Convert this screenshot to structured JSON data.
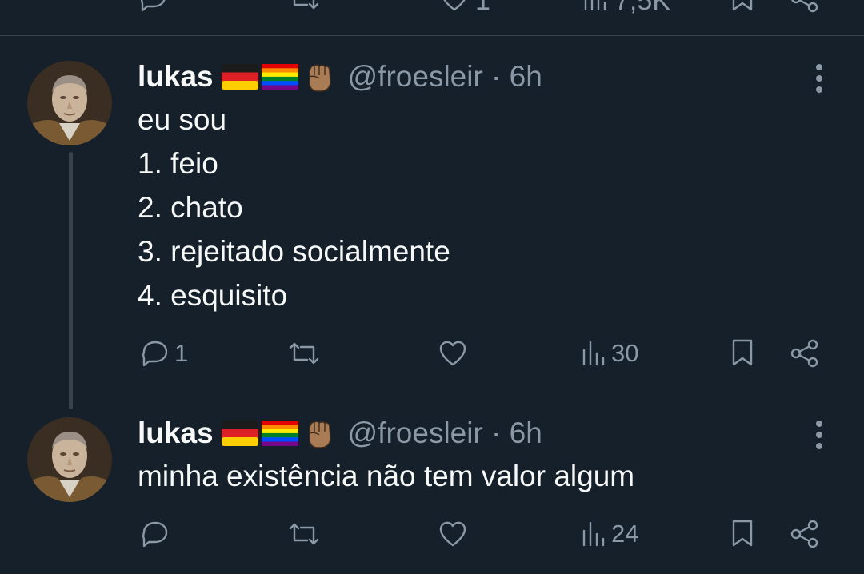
{
  "previous_tweet": {
    "views": "7,5K",
    "likes": "1"
  },
  "tweets": [
    {
      "name": "lukas",
      "emojis": [
        "germany-flag",
        "rainbow-flag",
        "raised-fist"
      ],
      "handle_time": "@froesleir · 6h",
      "lines": [
        "eu sou",
        "1. feio",
        "2. chato",
        "3. rejeitado socialmente",
        "4. esquisito"
      ],
      "replies": "1",
      "retweets": "",
      "likes": "",
      "views": "30"
    },
    {
      "name": "lukas",
      "emojis": [
        "germany-flag",
        "rainbow-flag",
        "raised-fist"
      ],
      "handle_time": "@froesleir · 6h",
      "lines": [
        "minha existência não tem valor algum"
      ],
      "replies": "",
      "retweets": "",
      "likes": "",
      "views": "24"
    }
  ],
  "colors": {
    "background": "#15202b",
    "text": "#f7f9f9",
    "muted": "#8b98a5",
    "divider": "#38444d"
  }
}
